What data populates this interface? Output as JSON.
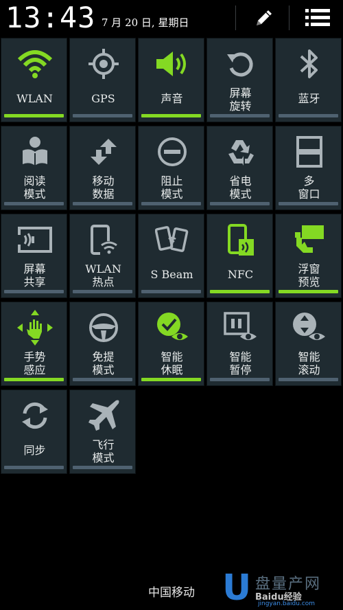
{
  "status": {
    "time": "13:43",
    "date": "7 月 20 日, 星期日"
  },
  "colors": {
    "active_green": "#84d923",
    "tile_bg": "#1f2b31",
    "bar_off": "#4f6170",
    "icon_grey": "#aab3b8"
  },
  "tiles": [
    {
      "label": "WLAN",
      "icon": "wifi-icon",
      "active": true
    },
    {
      "label": "GPS",
      "icon": "gps-icon",
      "active": false
    },
    {
      "label": "声音",
      "icon": "sound-icon",
      "active": true
    },
    {
      "label": "屏幕\n旋转",
      "icon": "rotate-icon",
      "active": false
    },
    {
      "label": "蓝牙",
      "icon": "bluetooth-icon",
      "active": false
    },
    {
      "label": "阅读\n模式",
      "icon": "reading-icon",
      "active": false
    },
    {
      "label": "移动\n数据",
      "icon": "mobile-data-icon",
      "active": false
    },
    {
      "label": "阻止\n模式",
      "icon": "block-icon",
      "active": false
    },
    {
      "label": "省电\n模式",
      "icon": "power-saving-icon",
      "active": false
    },
    {
      "label": "多\n窗口",
      "icon": "multi-window-icon",
      "active": false
    },
    {
      "label": "屏幕\n共享",
      "icon": "screen-share-icon",
      "active": false
    },
    {
      "label": "WLAN\n热点",
      "icon": "hotspot-icon",
      "active": false
    },
    {
      "label": "S Beam",
      "icon": "s-beam-icon",
      "active": false
    },
    {
      "label": "NFC",
      "icon": "nfc-icon",
      "active": true
    },
    {
      "label": "浮窗\n预览",
      "icon": "air-view-icon",
      "active": true
    },
    {
      "label": "手势\n感应",
      "icon": "gesture-icon",
      "active": true
    },
    {
      "label": "免提\n模式",
      "icon": "driving-icon",
      "active": false
    },
    {
      "label": "智能\n休眠",
      "icon": "smart-stay-icon",
      "active": true
    },
    {
      "label": "智能\n暂停",
      "icon": "smart-pause-icon",
      "active": false
    },
    {
      "label": "智能\n滚动",
      "icon": "smart-scroll-icon",
      "active": false
    },
    {
      "label": "同步",
      "icon": "sync-icon",
      "active": false
    },
    {
      "label": "飞行\n模式",
      "icon": "airplane-icon",
      "active": false
    }
  ],
  "footer": {
    "carrier": "中国移动"
  },
  "watermark": {
    "mark": "U",
    "line1": "盘量产网",
    "line2": "Baidu经验",
    "line3": "jingyan.baidu.com"
  }
}
